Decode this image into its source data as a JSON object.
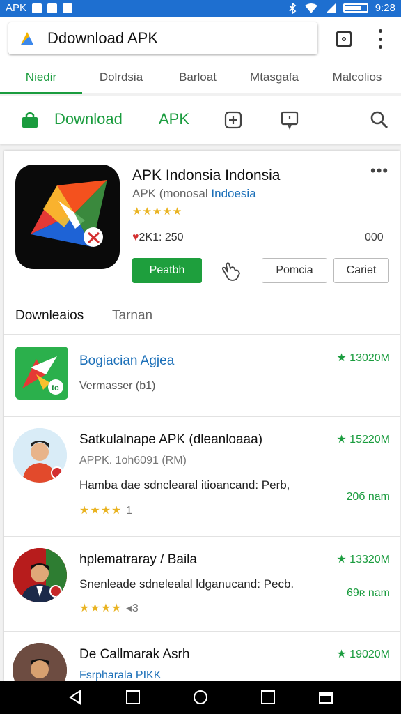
{
  "status_bar": {
    "left_text": "APK",
    "time": "9:28"
  },
  "browser": {
    "url": "Ddownload APK"
  },
  "categories": [
    {
      "label": "Niedir",
      "active": true
    },
    {
      "label": "Dolrdsia",
      "active": false
    },
    {
      "label": "Barloat",
      "active": false
    },
    {
      "label": "Mtasgafa",
      "active": false
    },
    {
      "label": "Malcolios",
      "active": false
    }
  ],
  "store_bar": {
    "download": "Download",
    "apk": "APK"
  },
  "app": {
    "title": "APK Indonsia Indonsia",
    "subtitle_prefix": "APK (monosal ",
    "subtitle_link": "Indoesia",
    "stars": "★★★★★",
    "more": "•••",
    "likes_icon": "♥",
    "likes": "2K1: 250",
    "count": "000",
    "primary_button": "Peatbh",
    "button_2": "Pomcia",
    "button_3": "Cariet"
  },
  "subtabs": {
    "tab1": "Downleaios",
    "tab2": "Tarnan"
  },
  "list": [
    {
      "name": "Bogiacian Agjea",
      "meta": "Vermasser (b1)",
      "rating": "★ 13020M"
    },
    {
      "name": "Satkulalnape APK (dleanloaaa)",
      "meta": "APPK. 1oh6091 (RM)",
      "desc": "Hamba dae sdnclearal itioancand: Perb,",
      "stars": "★★★★",
      "star_count": "1",
      "rating": "★ 15220M",
      "size": "20б nam"
    },
    {
      "name": "hplematraray / Baila",
      "desc": "Snenleade sdnelealal ldganucand: Pecb.",
      "stars": "★★★★",
      "star_count": "◂3",
      "rating": "★ 13320M",
      "size": "69ʀ nam"
    },
    {
      "name": "De Callmarak Asrh",
      "meta": "Fsrpharala PIKK",
      "rating": "★ 19020M"
    }
  ],
  "colors": {
    "accent_green": "#1a9c3e",
    "status_blue": "#1e6fd0",
    "link_blue": "#1b6fb8"
  }
}
